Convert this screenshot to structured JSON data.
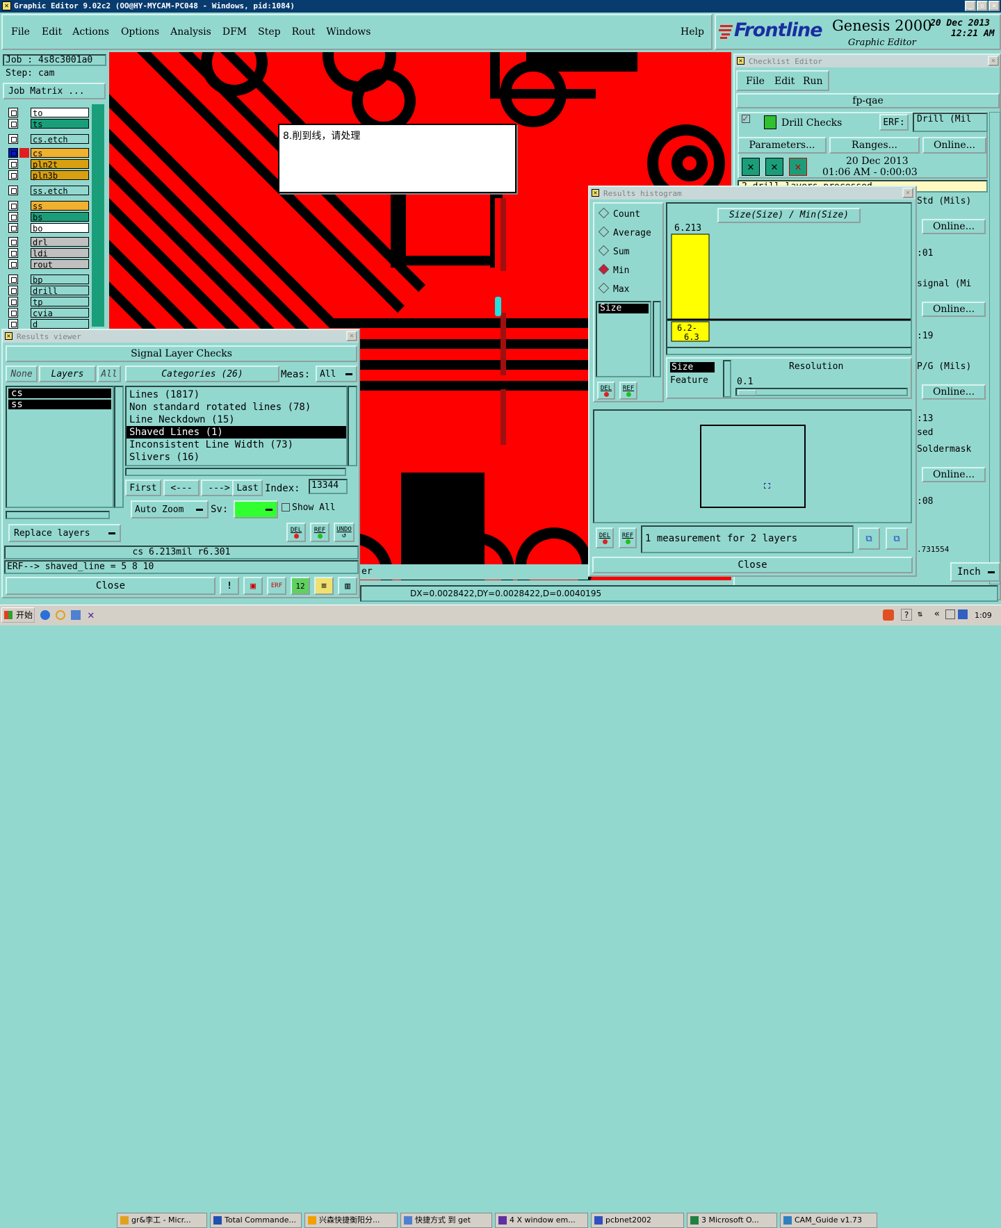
{
  "window": {
    "title": "Graphic Editor 9.02c2  (OO@HY-MYCAM-PC048 - Windows, pid:1084)"
  },
  "menu": {
    "items": [
      "File",
      "Edit",
      "Actions",
      "Options",
      "Analysis",
      "DFM",
      "Step",
      "Rout",
      "Windows"
    ],
    "help": "Help"
  },
  "brand": {
    "logo": "Frontline",
    "product": "Genesis 2000",
    "subtitle": "Graphic Editor",
    "date": "20 Dec 2013",
    "time": "12:21 AM"
  },
  "job": {
    "job_label": "Job : 4s8c3001a0",
    "step_label": "Step: cam",
    "matrix_button": "Job Matrix ..."
  },
  "layers": [
    {
      "name": "to",
      "color": "#ffffff"
    },
    {
      "name": "ts",
      "color": "#1a9e7a"
    },
    {
      "name": "cs.etch",
      "color": "#93d8cf"
    },
    {
      "name": "cs",
      "color": "#f0b030"
    },
    {
      "name": "pln2t",
      "color": "#d8a010"
    },
    {
      "name": "pln3b",
      "color": "#d8a010"
    },
    {
      "name": "ss.etch",
      "color": "#93d8cf"
    },
    {
      "name": "ss",
      "color": "#f0b030"
    },
    {
      "name": "bs",
      "color": "#1a9e7a"
    },
    {
      "name": "bo",
      "color": "#ffffff"
    },
    {
      "name": "drl",
      "color": "#c0c0c0"
    },
    {
      "name": "ldi",
      "color": "#c0c0c0"
    },
    {
      "name": "rout",
      "color": "#c0c0c0"
    },
    {
      "name": "bp",
      "color": "#93d8cf"
    },
    {
      "name": "drill",
      "color": "#93d8cf"
    },
    {
      "name": "tp",
      "color": "#93d8cf"
    },
    {
      "name": "cvia",
      "color": "#93d8cf"
    },
    {
      "name": "d",
      "color": "#93d8cf"
    }
  ],
  "annotation": {
    "text": "8.削到线，请处理"
  },
  "results_viewer": {
    "title": "Results viewer",
    "header": "Signal Layer Checks",
    "none_btn": "None",
    "layers_btn": "Layers",
    "all_btn": "All",
    "categories_btn": "Categories (26)",
    "meas_label": "Meas:",
    "meas_value": "All",
    "layer_list": [
      "cs",
      "ss"
    ],
    "categories": [
      "Lines (1817)",
      "Non standard rotated lines (78)",
      "Line Neckdown (15)",
      "Shaved Lines (1)",
      "Inconsistent Line Width (73)",
      "Slivers (16)"
    ],
    "selected_category": 3,
    "first": "First",
    "prev": "<---",
    "next": "--->",
    "last": "Last",
    "index_label": "Index:",
    "index_value": "13344",
    "auto_zoom": "Auto Zoom",
    "sv_label": "Sv:",
    "show_all": "Show All",
    "replace_layers": "Replace layers",
    "del": "DEL",
    "ref": "REF",
    "undo": "UNDO",
    "status": "cs 6.213mil  r6.301",
    "erf": "ERF--> shaved_line = 5 8 10",
    "close": "Close"
  },
  "checklist": {
    "title": "Checklist Editor",
    "menu": [
      "File",
      "Edit",
      "Run"
    ],
    "name": "fp-qae",
    "drill_checks": "Drill Checks",
    "erf_label": "ERF:",
    "erf_value": "Drill (Mil",
    "parameters": "Parameters...",
    "ranges": "Ranges...",
    "online": "Online...",
    "run_date": "20 Dec 2013",
    "run_time": "01:06 AM - 0:00:03",
    "status_line": "2 drill layers processed",
    "partial": [
      "Std (Mils)",
      ":01",
      "signal (Mi",
      ":19",
      "P/G (Mils)",
      ":13",
      "sed",
      "Soldermask",
      ":08",
      ".731554"
    ],
    "unit": "Inch"
  },
  "histogram": {
    "title": "Results histogram",
    "modes": [
      "Count",
      "Average",
      "Sum",
      "Min",
      "Max"
    ],
    "selected_mode": 3,
    "field_list": [
      "Size"
    ],
    "chart_title": "Size(Size) / Min(Size)",
    "resolution_label": "Resolution",
    "resolution_value": "0.1",
    "size_opt": "Size",
    "feature_opt": "Feature",
    "measurement": "1 measurement for 2 layers",
    "del": "DEL",
    "ref": "REF",
    "close": "Close"
  },
  "chart_data": {
    "type": "bar",
    "title": "Size(Size) / Min(Size)",
    "categories": [
      "6.2-6.3"
    ],
    "values": [
      6.213
    ],
    "bar_color": "#ffff00"
  },
  "status_bar": {
    "coords": "DX=0.0028422,DY=0.0028422,D=0.0040195",
    "partial": "er"
  },
  "taskbar": {
    "start": "开始",
    "items": [
      "gr&李工 - Micr...",
      "Total Commande...",
      "兴森快捷衡阳分...",
      "快捷方式 到 get",
      "4 X window em...",
      "pcbnet2002",
      "3 Microsoft O...",
      "CAM_Guide v1.73"
    ],
    "clock": "1:09"
  }
}
